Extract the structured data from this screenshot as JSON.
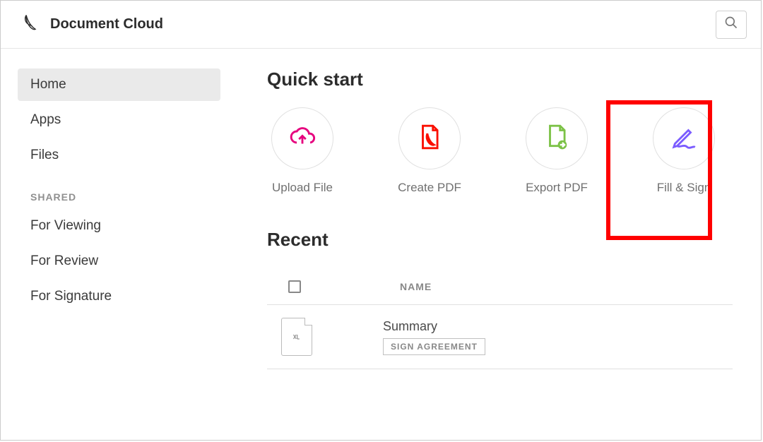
{
  "header": {
    "app_title": "Document Cloud"
  },
  "sidebar": {
    "items": [
      {
        "label": "Home",
        "active": true
      },
      {
        "label": "Apps",
        "active": false
      },
      {
        "label": "Files",
        "active": false
      }
    ],
    "shared_section_title": "SHARED",
    "shared_items": [
      {
        "label": "For Viewing"
      },
      {
        "label": "For Review"
      },
      {
        "label": "For Signature"
      }
    ]
  },
  "main": {
    "quick_start_heading": "Quick start",
    "quick_items": [
      {
        "label": "Upload File",
        "icon": "upload-cloud-icon",
        "color": "#e6007e"
      },
      {
        "label": "Create PDF",
        "icon": "pdf-file-icon",
        "color": "#fa0f00"
      },
      {
        "label": "Export PDF",
        "icon": "export-file-icon",
        "color": "#7cc247"
      },
      {
        "label": "Fill & Sign",
        "icon": "sign-pen-icon",
        "color": "#7b5cff"
      }
    ],
    "recent_heading": "Recent",
    "columns": {
      "name": "NAME"
    },
    "recent_files": [
      {
        "name": "Summary",
        "action_label": "SIGN AGREEMENT",
        "type": "xls"
      }
    ]
  },
  "annotation": {
    "highlighted_item_index": 3
  }
}
